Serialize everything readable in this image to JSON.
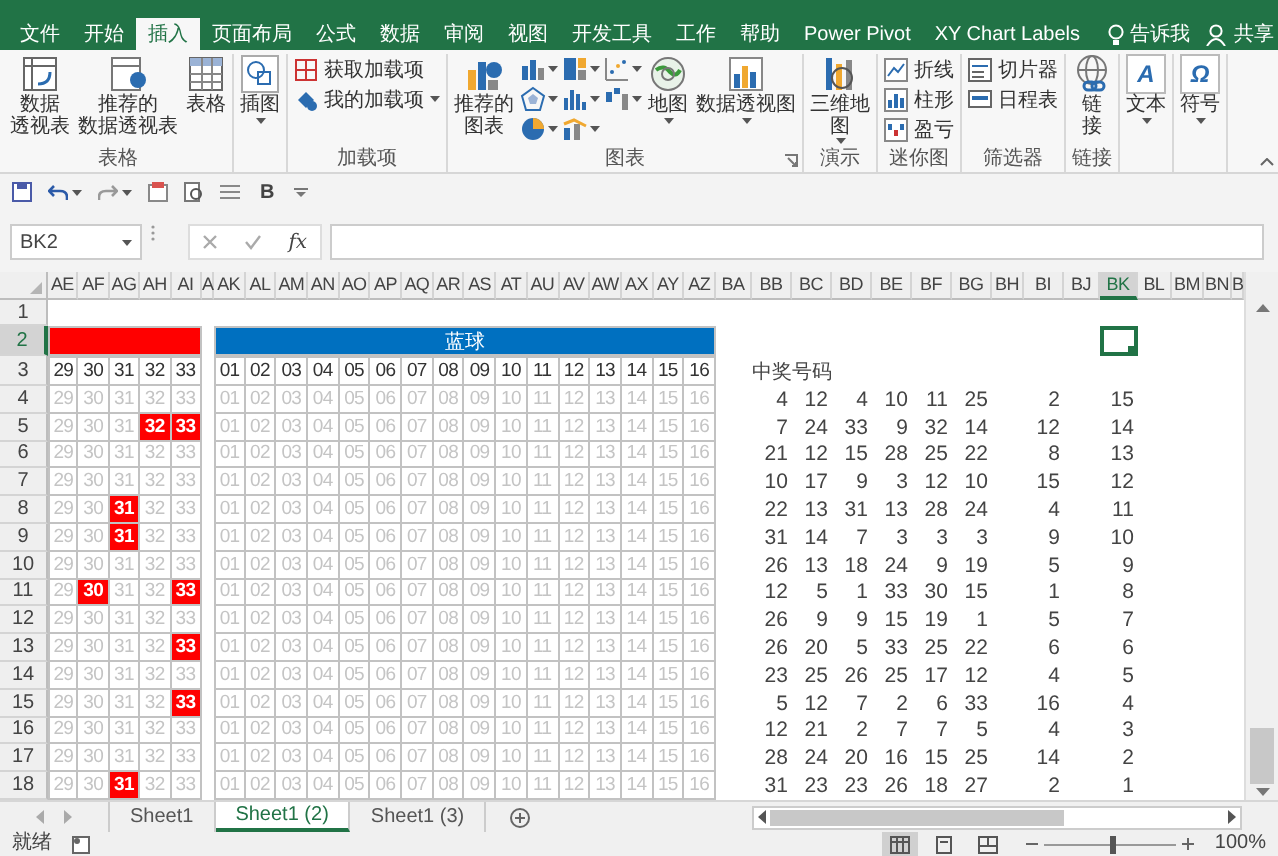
{
  "ribbon_tabs": [
    {
      "label": "文件",
      "selected": false
    },
    {
      "label": "开始",
      "selected": false
    },
    {
      "label": "插入",
      "selected": true
    },
    {
      "label": "页面布局",
      "selected": false
    },
    {
      "label": "公式",
      "selected": false
    },
    {
      "label": "数据",
      "selected": false
    },
    {
      "label": "审阅",
      "selected": false
    },
    {
      "label": "视图",
      "selected": false
    },
    {
      "label": "开发工具",
      "selected": false
    },
    {
      "label": "工作",
      "selected": false
    },
    {
      "label": "帮助",
      "selected": false
    },
    {
      "label": "Power Pivot",
      "selected": false
    },
    {
      "label": "XY Chart Labels",
      "selected": false
    }
  ],
  "tell_me": {
    "label": "告诉我"
  },
  "share": {
    "label": "共享"
  },
  "ribbon_groups": [
    {
      "label": "表格",
      "launcher": false,
      "items": [
        {
          "kind": "large",
          "label": "数据透视表",
          "dropdown": false
        },
        {
          "kind": "large",
          "label": "推荐的数据透视表",
          "dropdown": false
        },
        {
          "kind": "large",
          "label": "表格",
          "dropdown": false
        }
      ]
    },
    {
      "launcher": false,
      "items": [
        {
          "kind": "large",
          "label": "插图",
          "dropdown": true
        }
      ]
    },
    {
      "label": "加载项",
      "launcher": false,
      "items": [
        {
          "kind": "small",
          "label": "获取加载项",
          "dropdown": false
        },
        {
          "kind": "small",
          "label": "我的加载项",
          "dropdown": true
        }
      ]
    },
    {
      "label": "图表",
      "launcher": true,
      "items": [
        {
          "kind": "large",
          "label": "推荐的图表",
          "dropdown": false
        },
        {
          "kind": "chart_grid"
        },
        {
          "kind": "large",
          "label": "地图",
          "dropdown": true
        },
        {
          "kind": "large",
          "label": "数据透视图",
          "dropdown": true
        }
      ]
    },
    {
      "label": "演示",
      "launcher": false,
      "items": [
        {
          "kind": "large",
          "label": "三维地图",
          "dropdown": true
        }
      ]
    },
    {
      "label": "迷你图",
      "launcher": false,
      "items": [
        {
          "kind": "small",
          "label": "折线",
          "dropdown": false
        },
        {
          "kind": "small",
          "label": "柱形",
          "dropdown": false
        },
        {
          "kind": "small",
          "label": "盈亏",
          "dropdown": false
        }
      ]
    },
    {
      "label": "筛选器",
      "launcher": false,
      "items": [
        {
          "kind": "small",
          "label": "切片器",
          "dropdown": false
        },
        {
          "kind": "small",
          "label": "日程表",
          "dropdown": false
        }
      ]
    },
    {
      "label": "链接",
      "launcher": false,
      "items": [
        {
          "kind": "large",
          "label": "链接",
          "dropdown": false
        }
      ]
    },
    {
      "launcher": false,
      "items": [
        {
          "kind": "large",
          "glyph": "A",
          "label": "文本",
          "dropdown": true
        }
      ]
    },
    {
      "launcher": false,
      "items": [
        {
          "kind": "large",
          "glyph": "Ω",
          "label": "符号",
          "dropdown": true
        }
      ]
    }
  ],
  "quick_access": {
    "bold": "B"
  },
  "formula_bar": {
    "name_box": "BK2",
    "fx": "fx"
  },
  "sheet": {
    "columns": [
      {
        "label": "AE",
        "selected": false
      },
      {
        "label": "AF",
        "selected": false
      },
      {
        "label": "AG",
        "selected": false
      },
      {
        "label": "AH",
        "selected": false
      },
      {
        "label": "AI",
        "selected": false
      },
      {
        "label": "A",
        "selected": false
      },
      {
        "label": "AK",
        "selected": false
      },
      {
        "label": "AL",
        "selected": false
      },
      {
        "label": "AM",
        "selected": false
      },
      {
        "label": "AN",
        "selected": false
      },
      {
        "label": "AO",
        "selected": false
      },
      {
        "label": "AP",
        "selected": false
      },
      {
        "label": "AQ",
        "selected": false
      },
      {
        "label": "AR",
        "selected": false
      },
      {
        "label": "AS",
        "selected": false
      },
      {
        "label": "AT",
        "selected": false
      },
      {
        "label": "AU",
        "selected": false
      },
      {
        "label": "AV",
        "selected": false
      },
      {
        "label": "AW",
        "selected": false
      },
      {
        "label": "AX",
        "selected": false
      },
      {
        "label": "AY",
        "selected": false
      },
      {
        "label": "AZ",
        "selected": false
      },
      {
        "label": "BA",
        "selected": false
      },
      {
        "label": "BB",
        "selected": false
      },
      {
        "label": "BC",
        "selected": false
      },
      {
        "label": "BD",
        "selected": false
      },
      {
        "label": "BE",
        "selected": false
      },
      {
        "label": "BF",
        "selected": false
      },
      {
        "label": "BG",
        "selected": false
      },
      {
        "label": "BH",
        "selected": false
      },
      {
        "label": "BI",
        "selected": false
      },
      {
        "label": "BJ",
        "selected": false
      },
      {
        "label": "BK",
        "selected": true
      },
      {
        "label": "BL",
        "selected": false
      },
      {
        "label": "BM",
        "selected": false
      },
      {
        "label": "BN",
        "selected": false
      },
      {
        "label": "B",
        "selected": false
      }
    ],
    "rows": [
      {
        "label": "1",
        "selected": false
      },
      {
        "label": "2",
        "selected": true
      },
      {
        "label": "3",
        "selected": false
      },
      {
        "label": "4",
        "selected": false
      },
      {
        "label": "5",
        "selected": false
      },
      {
        "label": "6",
        "selected": false
      },
      {
        "label": "7",
        "selected": false
      },
      {
        "label": "8",
        "selected": false
      },
      {
        "label": "9",
        "selected": false
      },
      {
        "label": "10",
        "selected": false
      },
      {
        "label": "11",
        "selected": false
      },
      {
        "label": "12",
        "selected": false
      },
      {
        "label": "13",
        "selected": false
      },
      {
        "label": "14",
        "selected": false
      },
      {
        "label": "15",
        "selected": false
      },
      {
        "label": "16",
        "selected": false
      },
      {
        "label": "17",
        "selected": false
      },
      {
        "label": "18",
        "selected": false
      }
    ],
    "blue_title": "蓝球",
    "red_numbers": [
      "29",
      "30",
      "31",
      "32",
      "33"
    ],
    "blue_numbers": [
      "01",
      "02",
      "03",
      "04",
      "05",
      "06",
      "07",
      "08",
      "09",
      "10",
      "11",
      "12",
      "13",
      "14",
      "15",
      "16"
    ],
    "pool_rows": [
      {
        "red": [
          "29",
          "30",
          "31",
          "32",
          "33"
        ],
        "red_hit": [
          false,
          false,
          false,
          false,
          false
        ],
        "blue": [
          "01",
          "02",
          "03",
          "04",
          "05",
          "06",
          "07",
          "08",
          "09",
          "10",
          "11",
          "12",
          "13",
          "14",
          "15",
          "16"
        ],
        "blue_hit": [
          false,
          false,
          false,
          false,
          false,
          false,
          false,
          false,
          false,
          false,
          false,
          false,
          false,
          false,
          false,
          false
        ]
      },
      {
        "red": [
          "29",
          "30",
          "31",
          "32",
          "33"
        ],
        "red_hit": [
          false,
          false,
          false,
          true,
          true
        ],
        "blue": [
          "01",
          "02",
          "03",
          "04",
          "05",
          "06",
          "07",
          "08",
          "09",
          "10",
          "11",
          "12",
          "13",
          "14",
          "15",
          "16"
        ],
        "blue_hit": [
          false,
          false,
          false,
          false,
          false,
          false,
          false,
          false,
          false,
          false,
          false,
          false,
          false,
          false,
          false,
          false
        ]
      },
      {
        "red": [
          "29",
          "30",
          "31",
          "32",
          "33"
        ],
        "red_hit": [
          false,
          false,
          false,
          false,
          false
        ],
        "blue": [
          "01",
          "02",
          "03",
          "04",
          "05",
          "06",
          "07",
          "08",
          "09",
          "10",
          "11",
          "12",
          "13",
          "14",
          "15",
          "16"
        ],
        "blue_hit": [
          false,
          false,
          false,
          false,
          false,
          false,
          false,
          false,
          false,
          false,
          false,
          false,
          false,
          false,
          false,
          false
        ]
      },
      {
        "red": [
          "29",
          "30",
          "31",
          "32",
          "33"
        ],
        "red_hit": [
          false,
          false,
          false,
          false,
          false
        ],
        "blue": [
          "01",
          "02",
          "03",
          "04",
          "05",
          "06",
          "07",
          "08",
          "09",
          "10",
          "11",
          "12",
          "13",
          "14",
          "15",
          "16"
        ],
        "blue_hit": [
          false,
          false,
          false,
          false,
          false,
          false,
          false,
          false,
          false,
          false,
          false,
          false,
          false,
          false,
          false,
          false
        ]
      },
      {
        "red": [
          "29",
          "30",
          "31",
          "32",
          "33"
        ],
        "red_hit": [
          false,
          false,
          true,
          false,
          false
        ],
        "blue": [
          "01",
          "02",
          "03",
          "04",
          "05",
          "06",
          "07",
          "08",
          "09",
          "10",
          "11",
          "12",
          "13",
          "14",
          "15",
          "16"
        ],
        "blue_hit": [
          false,
          false,
          false,
          false,
          false,
          false,
          false,
          false,
          false,
          false,
          false,
          false,
          false,
          false,
          false,
          false
        ]
      },
      {
        "red": [
          "29",
          "30",
          "31",
          "32",
          "33"
        ],
        "red_hit": [
          false,
          false,
          true,
          false,
          false
        ],
        "blue": [
          "01",
          "02",
          "03",
          "04",
          "05",
          "06",
          "07",
          "08",
          "09",
          "10",
          "11",
          "12",
          "13",
          "14",
          "15",
          "16"
        ],
        "blue_hit": [
          false,
          false,
          false,
          false,
          false,
          false,
          false,
          false,
          false,
          false,
          false,
          false,
          false,
          false,
          false,
          false
        ]
      },
      {
        "red": [
          "29",
          "30",
          "31",
          "32",
          "33"
        ],
        "red_hit": [
          false,
          false,
          false,
          false,
          false
        ],
        "blue": [
          "01",
          "02",
          "03",
          "04",
          "05",
          "06",
          "07",
          "08",
          "09",
          "10",
          "11",
          "12",
          "13",
          "14",
          "15",
          "16"
        ],
        "blue_hit": [
          false,
          false,
          false,
          false,
          false,
          false,
          false,
          false,
          false,
          false,
          false,
          false,
          false,
          false,
          false,
          false
        ]
      },
      {
        "red": [
          "29",
          "30",
          "31",
          "32",
          "33"
        ],
        "red_hit": [
          false,
          true,
          false,
          false,
          true
        ],
        "blue": [
          "01",
          "02",
          "03",
          "04",
          "05",
          "06",
          "07",
          "08",
          "09",
          "10",
          "11",
          "12",
          "13",
          "14",
          "15",
          "16"
        ],
        "blue_hit": [
          false,
          false,
          false,
          false,
          false,
          false,
          false,
          false,
          false,
          false,
          false,
          false,
          false,
          false,
          false,
          false
        ]
      },
      {
        "red": [
          "29",
          "30",
          "31",
          "32",
          "33"
        ],
        "red_hit": [
          false,
          false,
          false,
          false,
          false
        ],
        "blue": [
          "01",
          "02",
          "03",
          "04",
          "05",
          "06",
          "07",
          "08",
          "09",
          "10",
          "11",
          "12",
          "13",
          "14",
          "15",
          "16"
        ],
        "blue_hit": [
          false,
          false,
          false,
          false,
          false,
          false,
          false,
          false,
          false,
          false,
          false,
          false,
          false,
          false,
          false,
          false
        ]
      },
      {
        "red": [
          "29",
          "30",
          "31",
          "32",
          "33"
        ],
        "red_hit": [
          false,
          false,
          false,
          false,
          true
        ],
        "blue": [
          "01",
          "02",
          "03",
          "04",
          "05",
          "06",
          "07",
          "08",
          "09",
          "10",
          "11",
          "12",
          "13",
          "14",
          "15",
          "16"
        ],
        "blue_hit": [
          false,
          false,
          false,
          false,
          false,
          false,
          false,
          false,
          false,
          false,
          false,
          false,
          false,
          false,
          false,
          false
        ]
      },
      {
        "red": [
          "29",
          "30",
          "31",
          "32",
          "33"
        ],
        "red_hit": [
          false,
          false,
          false,
          false,
          false
        ],
        "blue": [
          "01",
          "02",
          "03",
          "04",
          "05",
          "06",
          "07",
          "08",
          "09",
          "10",
          "11",
          "12",
          "13",
          "14",
          "15",
          "16"
        ],
        "blue_hit": [
          false,
          false,
          false,
          false,
          false,
          false,
          false,
          false,
          false,
          false,
          false,
          false,
          false,
          false,
          false,
          false
        ]
      },
      {
        "red": [
          "29",
          "30",
          "31",
          "32",
          "33"
        ],
        "red_hit": [
          false,
          false,
          false,
          false,
          true
        ],
        "blue": [
          "01",
          "02",
          "03",
          "04",
          "05",
          "06",
          "07",
          "08",
          "09",
          "10",
          "11",
          "12",
          "13",
          "14",
          "15",
          "16"
        ],
        "blue_hit": [
          false,
          false,
          false,
          false,
          false,
          false,
          false,
          false,
          false,
          false,
          false,
          false,
          false,
          false,
          false,
          false
        ]
      },
      {
        "red": [
          "29",
          "30",
          "31",
          "32",
          "33"
        ],
        "red_hit": [
          false,
          false,
          false,
          false,
          false
        ],
        "blue": [
          "01",
          "02",
          "03",
          "04",
          "05",
          "06",
          "07",
          "08",
          "09",
          "10",
          "11",
          "12",
          "13",
          "14",
          "15",
          "16"
        ],
        "blue_hit": [
          false,
          false,
          false,
          false,
          false,
          false,
          false,
          false,
          false,
          false,
          false,
          false,
          false,
          false,
          false,
          false
        ]
      },
      {
        "red": [
          "29",
          "30",
          "31",
          "32",
          "33"
        ],
        "red_hit": [
          false,
          false,
          false,
          false,
          false
        ],
        "blue": [
          "01",
          "02",
          "03",
          "04",
          "05",
          "06",
          "07",
          "08",
          "09",
          "10",
          "11",
          "12",
          "13",
          "14",
          "15",
          "16"
        ],
        "blue_hit": [
          false,
          false,
          false,
          false,
          false,
          false,
          false,
          false,
          false,
          false,
          false,
          false,
          false,
          false,
          false,
          false
        ]
      },
      {
        "red": [
          "29",
          "30",
          "31",
          "32",
          "33"
        ],
        "red_hit": [
          false,
          false,
          true,
          false,
          false
        ],
        "blue": [
          "01",
          "02",
          "03",
          "04",
          "05",
          "06",
          "07",
          "08",
          "09",
          "10",
          "11",
          "12",
          "13",
          "14",
          "15",
          "16"
        ],
        "blue_hit": [
          false,
          false,
          false,
          false,
          false,
          false,
          false,
          false,
          false,
          false,
          false,
          false,
          false,
          false,
          false,
          false
        ]
      }
    ],
    "winning_title": "中奖号码",
    "winning_rows": [
      [
        "4",
        "12",
        "4",
        "10",
        "11",
        "25",
        "2",
        "15"
      ],
      [
        "7",
        "24",
        "33",
        "9",
        "32",
        "14",
        "12",
        "14"
      ],
      [
        "21",
        "12",
        "15",
        "28",
        "25",
        "22",
        "8",
        "13"
      ],
      [
        "10",
        "17",
        "9",
        "3",
        "12",
        "10",
        "15",
        "12"
      ],
      [
        "22",
        "13",
        "31",
        "13",
        "28",
        "24",
        "4",
        "11"
      ],
      [
        "31",
        "14",
        "7",
        "3",
        "3",
        "3",
        "9",
        "10"
      ],
      [
        "26",
        "13",
        "18",
        "24",
        "9",
        "19",
        "5",
        "9"
      ],
      [
        "12",
        "5",
        "1",
        "33",
        "30",
        "15",
        "1",
        "8"
      ],
      [
        "26",
        "9",
        "9",
        "15",
        "19",
        "1",
        "5",
        "7"
      ],
      [
        "26",
        "20",
        "5",
        "33",
        "25",
        "22",
        "6",
        "6"
      ],
      [
        "23",
        "25",
        "26",
        "25",
        "17",
        "12",
        "4",
        "5"
      ],
      [
        "5",
        "12",
        "7",
        "2",
        "6",
        "33",
        "16",
        "4"
      ],
      [
        "12",
        "21",
        "2",
        "7",
        "7",
        "5",
        "4",
        "3"
      ],
      [
        "28",
        "24",
        "20",
        "16",
        "15",
        "25",
        "14",
        "2"
      ],
      [
        "31",
        "23",
        "23",
        "26",
        "18",
        "27",
        "2",
        "1"
      ]
    ]
  },
  "sheet_tabs": [
    {
      "label": "Sheet1",
      "selected": false
    },
    {
      "label": "Sheet1 (2)",
      "selected": true
    },
    {
      "label": "Sheet1 (3)",
      "selected": false
    }
  ],
  "status_bar": {
    "text": "就绪",
    "views": [
      {
        "selected": true
      },
      {
        "selected": false
      },
      {
        "selected": false
      }
    ],
    "zoom": {
      "level": 0.52,
      "label": "100%"
    }
  }
}
